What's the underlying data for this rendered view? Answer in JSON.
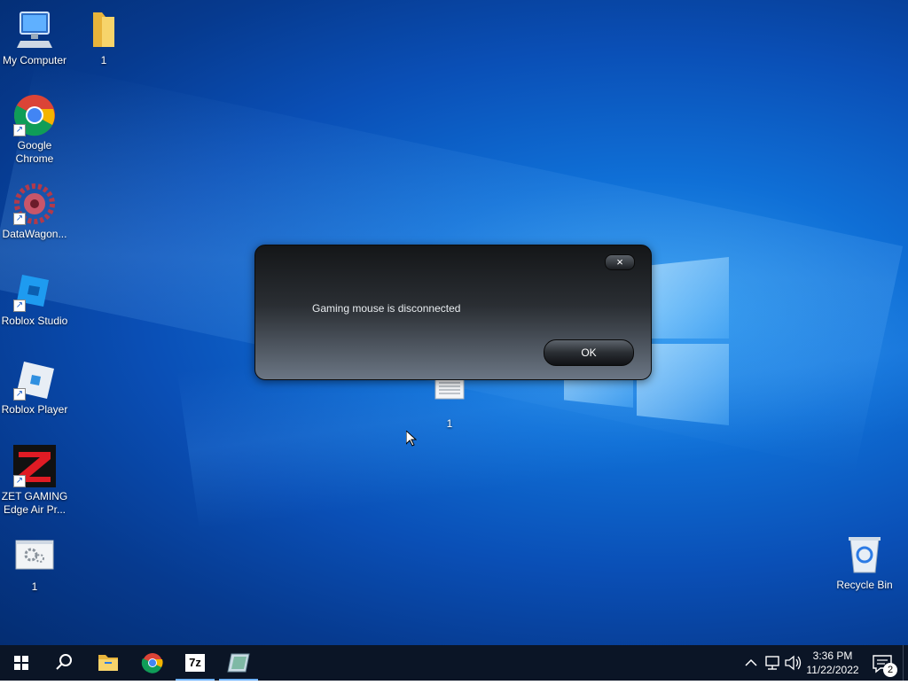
{
  "desktop_icons": [
    {
      "label": "My Computer",
      "icon": "computer-icon"
    },
    {
      "label": "1",
      "icon": "folder-icon"
    },
    {
      "label": "Google Chrome",
      "icon": "chrome-icon"
    },
    {
      "label": "DataWagon...",
      "icon": "datawagon-icon"
    },
    {
      "label": "Roblox Studio",
      "icon": "roblox-studio-icon"
    },
    {
      "label": "Roblox Player",
      "icon": "roblox-player-icon"
    },
    {
      "label": "ZET GAMING Edge Air Pr...",
      "icon": "zet-gaming-icon"
    },
    {
      "label": "1",
      "icon": "settings-file-icon"
    },
    {
      "label": "1",
      "icon": "text-file-icon"
    },
    {
      "label": "Recycle Bin",
      "icon": "recycle-bin-icon"
    }
  ],
  "dialog": {
    "close_label": "×",
    "message": "Gaming mouse is disconnected",
    "ok_label": "OK"
  },
  "taskbar": {
    "items": [
      {
        "icon": "windows-start-icon"
      },
      {
        "icon": "search-icon"
      },
      {
        "icon": "file-explorer-icon"
      },
      {
        "icon": "chrome-icon"
      },
      {
        "icon": "7zip-icon",
        "label": "7z"
      },
      {
        "icon": "app-icon"
      }
    ],
    "clock_time": "3:36 PM",
    "clock_date": "11/22/2022",
    "notification_count": "2"
  },
  "colors": {
    "wallpaper": "#0a4fb6",
    "taskbar": "#0b1526",
    "accent": "#6fb3ff"
  }
}
